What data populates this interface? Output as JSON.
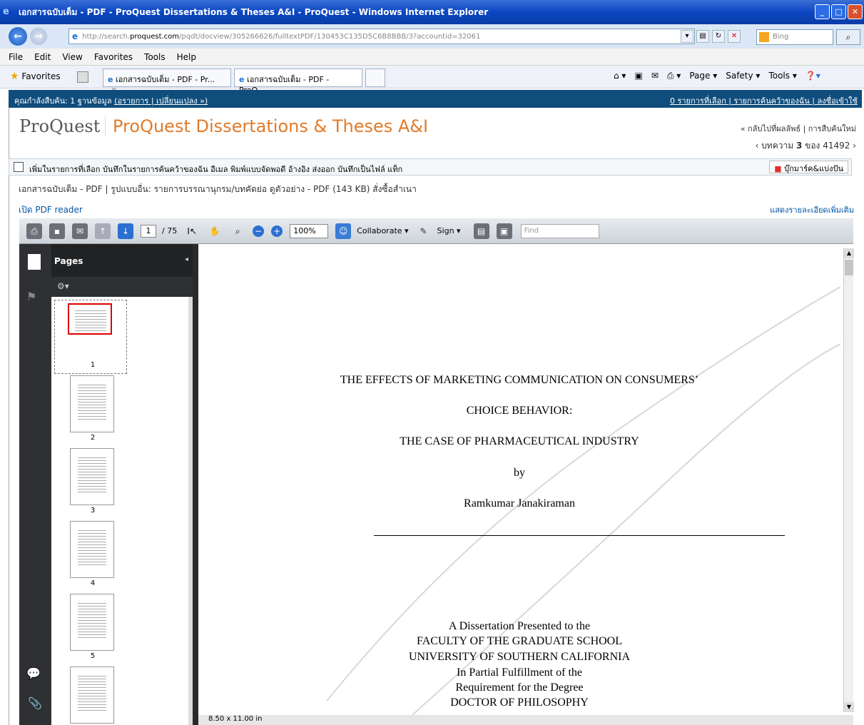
{
  "window": {
    "title": "เอกสารฉบับเต็ม - PDF - ProQuest Dissertations & Theses A&I - ProQuest - Windows Internet Explorer"
  },
  "address": {
    "url_prefix": "http://search.",
    "url_domain": "proquest.com",
    "url_path": "/pqdt/docview/305266626/fulltextPDF/130453C135D5C6B8BBB/3?accountid=32061",
    "search_placeholder": "Bing"
  },
  "menu": [
    "File",
    "Edit",
    "View",
    "Favorites",
    "Tools",
    "Help"
  ],
  "favorites": {
    "label": "Favorites",
    "tabs": [
      "เอกสารฉบับเต็ม - PDF - Pr...",
      "เอกสารฉบับเต็ม - PDF - ProQ..."
    ],
    "commands": [
      "Page ▾",
      "Safety ▾",
      "Tools ▾"
    ]
  },
  "pq_status": {
    "left": "คุณกำลังสืบค้น: 1 ฐานข้อมูล",
    "left_links": "(อรายการ | เปลี่ยนแปลง »)",
    "right": "0 รายการที่เลือก | รายการค้นคว้าของฉัน | ลงชื่อเข้าใช้"
  },
  "header": {
    "logo": "ProQuest",
    "database_title": "ProQuest Dissertations & Theses A&I",
    "back_links": "« กลับไปที่ผลลัพธ์ | การสืบค้นใหม่",
    "record_nav_prefix": "‹  บทความ ",
    "record_current": "3",
    "record_nav_suffix": " ของ 41492  ›"
  },
  "actions": {
    "items": "เพิ่มในรายการที่เลือก   บันทึกในรายการค้นคว้าของฉัน  อีเมล   พิมพ์แบบจัดพอดี   อ้างอิง   ส่งออก   บันทึกเป็นไฟล์   แท็ก",
    "share": "บุ๊กมาร์ค&แบ่งปัน"
  },
  "formats": {
    "text": "เอกสารฉบับเต็ม - PDF  |  รูปแบบอื่น:   รายการบรรณานุกรม/บทคัดย่อ   ดูตัวอย่าง - PDF (143 KB)   สั่งซื้อสำเนา"
  },
  "links": {
    "open_pdf": "เปิด PDF reader",
    "more_detail": "แสดงรายละเอียดเพิ่มเติม"
  },
  "viewer": {
    "page_current": "1",
    "page_total": "/ 75",
    "zoom": "100%",
    "collaborate": "Collaborate ▾",
    "sign": "Sign ▾",
    "find_placeholder": "Find",
    "pages_label": "Pages",
    "thumb_numbers": [
      "1",
      "2",
      "3",
      "4",
      "5"
    ],
    "page_size": "8.50 x 11.00 in"
  },
  "document": {
    "title_line1": "THE EFFECTS OF MARKETING COMMUNICATION ON CONSUMERS’",
    "title_line2": "CHOICE BEHAVIOR:",
    "title_line3": "THE CASE OF  PHARMACEUTICAL INDUSTRY",
    "by": "by",
    "author": "Ramkumar Janakiraman",
    "lines": [
      "A Dissertation Presented to the",
      "FACULTY OF THE GRADUATE SCHOOL",
      "UNIVERSITY OF SOUTHERN CALIFORNIA",
      "In Partial Fulfillment of the",
      "Requirement for the Degree",
      "DOCTOR OF PHILOSOPHY"
    ]
  },
  "colors": {
    "accent_orange": "#e07b2a",
    "status_bar": "#0f4d7c"
  }
}
